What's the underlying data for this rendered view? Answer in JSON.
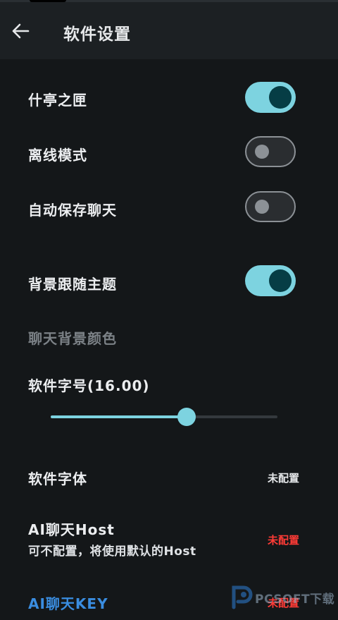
{
  "header": {
    "title": "软件设置"
  },
  "settings": {
    "zen_box": {
      "label": "什亭之匣",
      "on": true
    },
    "offline": {
      "label": "离线模式",
      "on": false
    },
    "autosave": {
      "label": "自动保存聊天",
      "on": false
    },
    "bg_theme": {
      "label": "背景跟随主题",
      "on": true
    },
    "chat_bg_color": {
      "label": "聊天背景颜色"
    },
    "font_size": {
      "label": "软件字号(16.00)",
      "value": 16.0,
      "fraction": 0.6
    },
    "font": {
      "label": "软件字体",
      "value": "未配置"
    },
    "ai_host": {
      "label": "AI聊天Host",
      "description": "可不配置，将使用默认的Host",
      "value": "未配置"
    },
    "ai_key": {
      "label": "AI聊天KEY",
      "value": "未配置"
    }
  },
  "watermark": {
    "text": "PCSOFT下载"
  },
  "colors": {
    "accent": "#7dd3e0",
    "warning": "#ff3b36",
    "link": "#3a8de0"
  },
  "icons": {
    "back": "arrow-left-icon",
    "watermark": "pcsoft-logo-icon"
  }
}
